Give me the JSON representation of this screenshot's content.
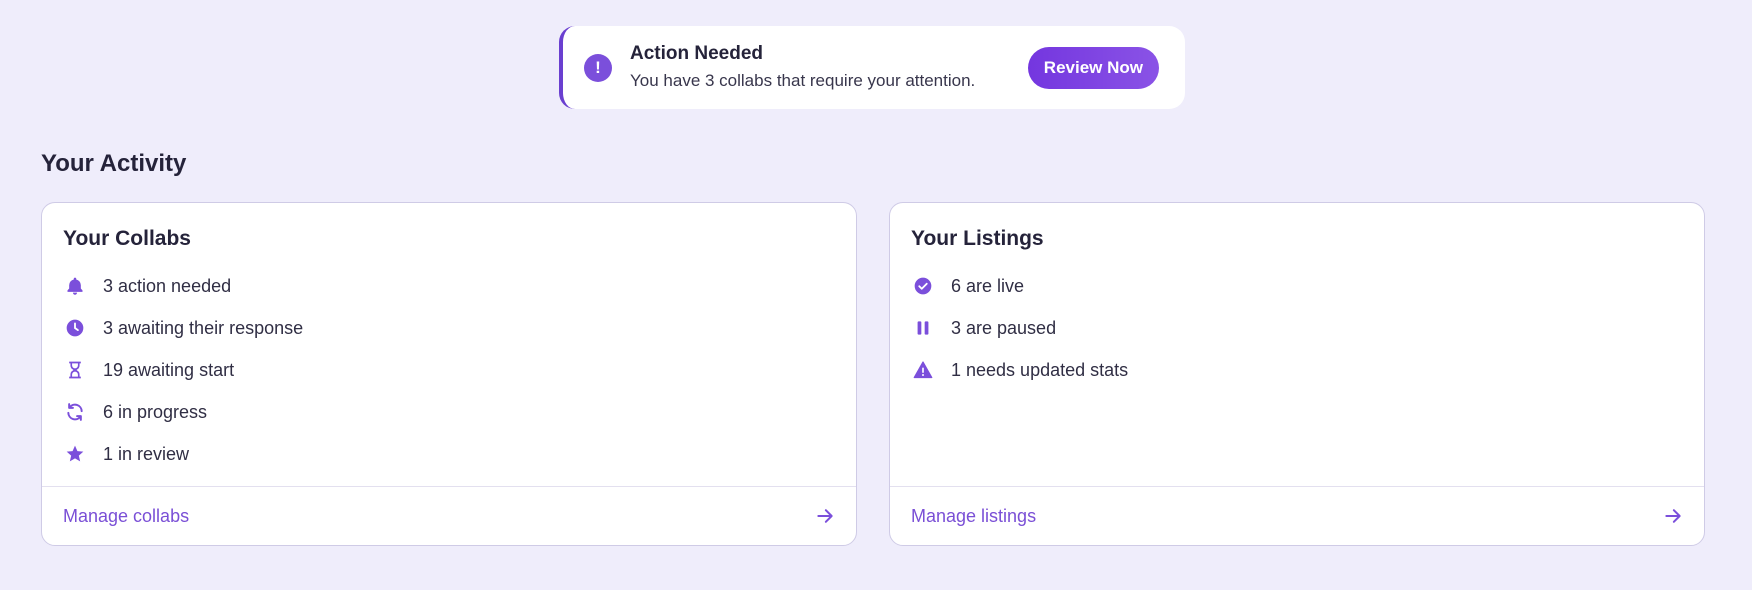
{
  "alert": {
    "icon": "exclamation-circle-icon",
    "title": "Action Needed",
    "message": "You have 3 collabs that require your attention.",
    "button_label": "Review Now"
  },
  "activity": {
    "heading": "Your Activity",
    "collabs": {
      "title": "Your Collabs",
      "items": [
        {
          "icon": "bell-icon",
          "label": "3 action needed"
        },
        {
          "icon": "clock-icon",
          "label": "3 awaiting their response"
        },
        {
          "icon": "hourglass-icon",
          "label": "19 awaiting start"
        },
        {
          "icon": "refresh-icon",
          "label": "6 in progress"
        },
        {
          "icon": "star-icon",
          "label": "1 in review"
        }
      ],
      "footer_link": "Manage collabs"
    },
    "listings": {
      "title": "Your Listings",
      "items": [
        {
          "icon": "check-circle-icon",
          "label": "6 are live"
        },
        {
          "icon": "pause-icon",
          "label": "3 are paused"
        },
        {
          "icon": "warning-icon",
          "label": "1 needs updated stats"
        }
      ],
      "footer_link": "Manage listings"
    }
  },
  "colors": {
    "accent": "#7b4fdb",
    "background": "#efedfb",
    "text": "#25233a"
  }
}
